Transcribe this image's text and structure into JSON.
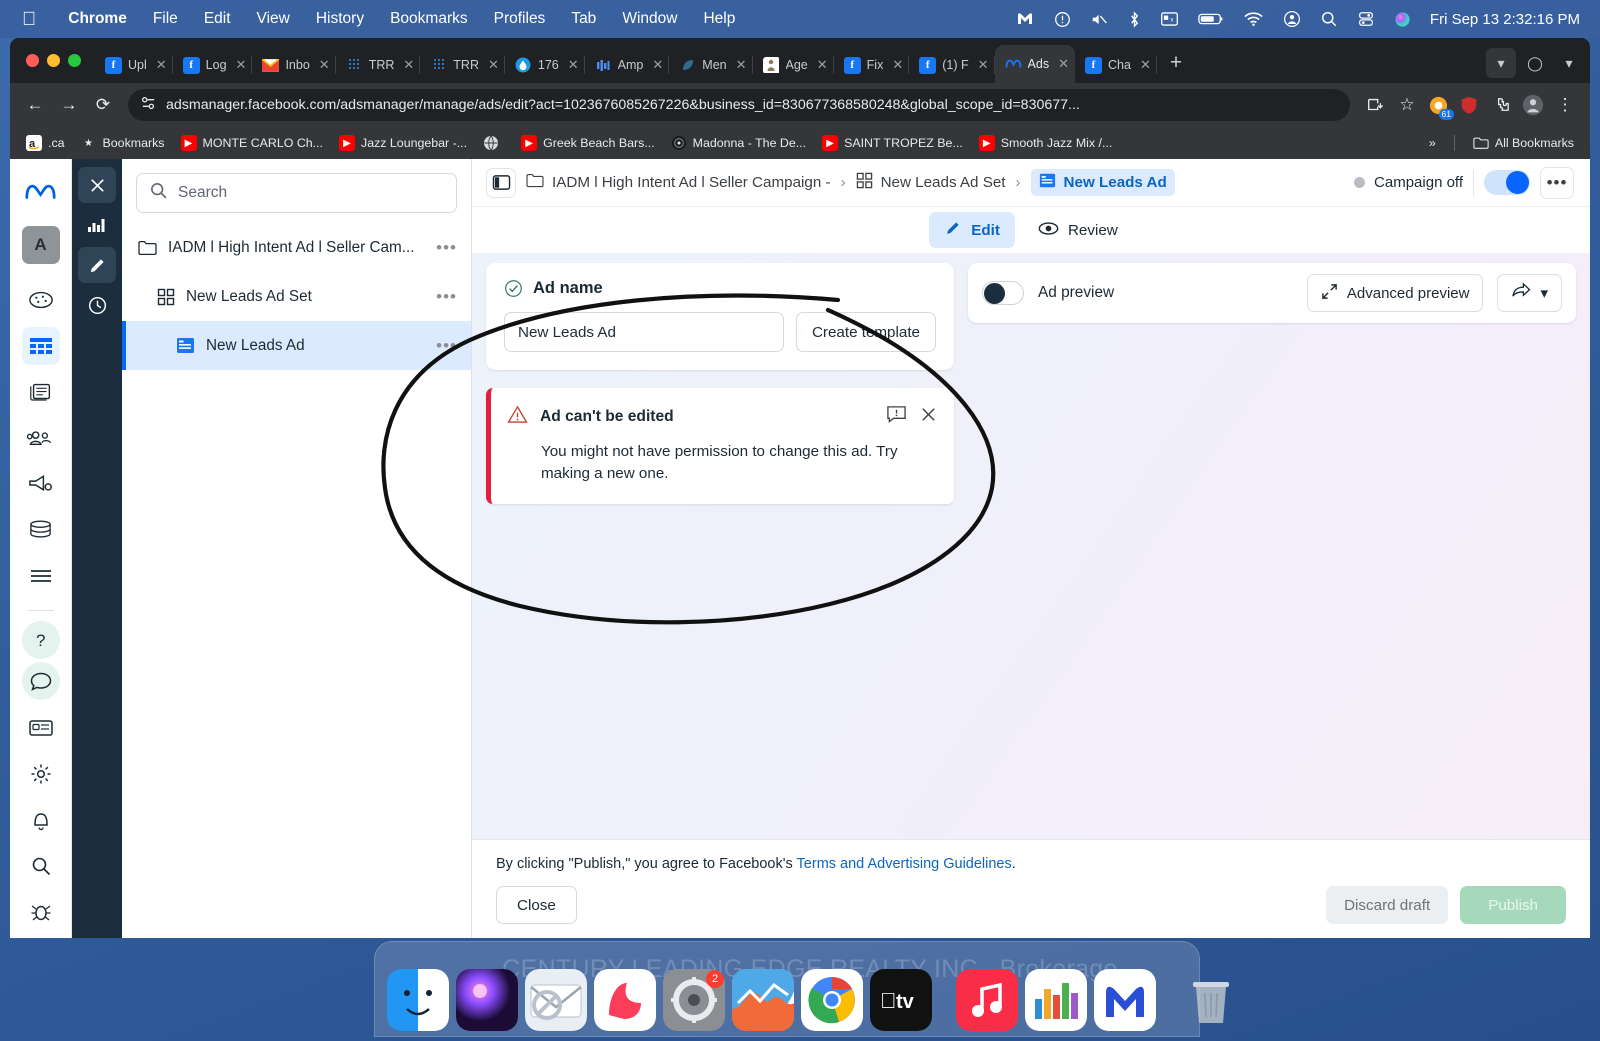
{
  "menubar": {
    "apple": "apple-logo",
    "items": [
      "Chrome",
      "File",
      "Edit",
      "View",
      "History",
      "Bookmarks",
      "Profiles",
      "Tab",
      "Window",
      "Help"
    ],
    "clock": "Fri Sep 13  2:32:16 PM",
    "status_icons": [
      "malwarebytes-icon",
      "do-not-disturb-icon",
      "mute-icon",
      "bluetooth-icon",
      "screen-icon",
      "battery-icon",
      "wifi-icon",
      "account-icon",
      "spotlight-icon",
      "control-center-icon",
      "siri-icon"
    ]
  },
  "browser": {
    "tabs": [
      {
        "label": "Upl",
        "favicon": "facebook"
      },
      {
        "label": "Log",
        "favicon": "facebook"
      },
      {
        "label": "Inbo",
        "favicon": "gmail"
      },
      {
        "label": "TRR",
        "favicon": "trreb"
      },
      {
        "label": "TRR",
        "favicon": "trreb"
      },
      {
        "label": "176",
        "favicon": "drop"
      },
      {
        "label": "Amp",
        "favicon": "bars"
      },
      {
        "label": "Men",
        "favicon": "leaf"
      },
      {
        "label": "Age",
        "favicon": "person"
      },
      {
        "label": "Fix",
        "favicon": "facebook"
      },
      {
        "label": "(1) F",
        "favicon": "facebook"
      },
      {
        "label": "Ads",
        "favicon": "meta",
        "active": true
      },
      {
        "label": "Cha",
        "favicon": "facebook"
      }
    ],
    "new_tab": "+",
    "close_glyph": "✕",
    "nav": {
      "back": "←",
      "forward": "→",
      "reload": "⟳"
    },
    "url": "adsmanager.facebook.com/adsmanager/manage/ads/edit?act=1023676085267226&business_id=830677368580248&global_scope_id=830677...",
    "extension_badge_count": "61",
    "bookmarks": [
      {
        "label": ".ca",
        "icon": "amazon"
      },
      {
        "label": "Bookmarks",
        "icon": "star"
      },
      {
        "label": "MONTE CARLO Ch...",
        "icon": "youtube"
      },
      {
        "label": "Jazz Loungebar -...",
        "icon": "youtube"
      },
      {
        "label": "",
        "icon": "globe"
      },
      {
        "label": "Greek Beach Bars...",
        "icon": "youtube"
      },
      {
        "label": "Madonna - The De...",
        "icon": "vinyl"
      },
      {
        "label": "SAINT TROPEZ Be...",
        "icon": "youtube"
      },
      {
        "label": "Smooth Jazz Mix /...",
        "icon": "youtube"
      }
    ],
    "bookmarks_overflow": "»",
    "all_bookmarks": "All Bookmarks"
  },
  "rail": {
    "logo": "meta-logo",
    "avatar_letter": "A",
    "icons": [
      "dashboard-icon",
      "table-icon",
      "news-icon",
      "audience-icon",
      "megaphone-icon",
      "billing-icon",
      "menu-icon",
      "help-icon",
      "chat-icon",
      "card-icon",
      "gear-icon",
      "bell-icon",
      "search-icon",
      "bug-icon"
    ]
  },
  "minirail": {
    "icons": [
      "close-icon",
      "chart-icon",
      "pencil-icon",
      "clock-icon"
    ]
  },
  "navpanel": {
    "search_placeholder": "Search",
    "rows": [
      {
        "label": "IADM l High Intent Ad l Seller Cam...",
        "icon": "folder-icon",
        "level": 1,
        "dots": "•••"
      },
      {
        "label": "New Leads Ad Set",
        "icon": "adset-icon",
        "level": 2,
        "dots": "•••"
      },
      {
        "label": "New Leads Ad",
        "icon": "ad-icon",
        "level": 3,
        "dots": "•••",
        "active": true
      }
    ]
  },
  "breadcrumb": {
    "campaign": "IADM l High Intent Ad l Seller Campaign -",
    "adset": "New Leads Ad Set",
    "ad": "New Leads Ad",
    "separator": "›",
    "status_label": "Campaign off",
    "kebab": "•••"
  },
  "modetabs": [
    {
      "label": "Edit",
      "icon": "pencil-icon",
      "active": true
    },
    {
      "label": "Review",
      "icon": "eye-icon",
      "active": false
    }
  ],
  "adname_card": {
    "title": "Ad name",
    "value": "New Leads Ad",
    "create_template": "Create template"
  },
  "error_card": {
    "title": "Ad can't be edited",
    "body": "You might not have permission to change this ad. Try making a new one.",
    "feedback_icon": "feedback-icon",
    "close_icon": "✕"
  },
  "preview": {
    "toggle_label": "Ad preview",
    "advanced_preview": "Advanced preview",
    "share_icon": "share-icon",
    "chevron": "▾"
  },
  "footer": {
    "terms_prefix": "By clicking \"Publish,\" you agree to Facebook's ",
    "terms_link": "Terms and Advertising Guidelines",
    "terms_suffix": ".",
    "close": "Close",
    "discard": "Discard draft",
    "publish": "Publish"
  },
  "desktop": {
    "watermark": "CENTURY LEADING EDGE REALTY INC., Brokerage"
  },
  "dock": {
    "items": [
      {
        "name": "finder",
        "badge": ""
      },
      {
        "name": "siri",
        "badge": ""
      },
      {
        "name": "mail",
        "badge": ""
      },
      {
        "name": "news",
        "badge": ""
      },
      {
        "name": "settings",
        "badge": "2"
      },
      {
        "name": "stocks",
        "badge": ""
      },
      {
        "name": "chrome",
        "badge": ""
      },
      {
        "name": "appletv",
        "badge": ""
      },
      {
        "name": "music",
        "badge": ""
      },
      {
        "name": "numbers",
        "badge": ""
      },
      {
        "name": "malwarebytes",
        "badge": ""
      },
      {
        "name": "trash",
        "badge": ""
      }
    ]
  },
  "colors": {
    "accent": "#0866ff",
    "error": "#e41e3f",
    "menubar": "#3a619d",
    "chrome_dark": "#202124"
  }
}
